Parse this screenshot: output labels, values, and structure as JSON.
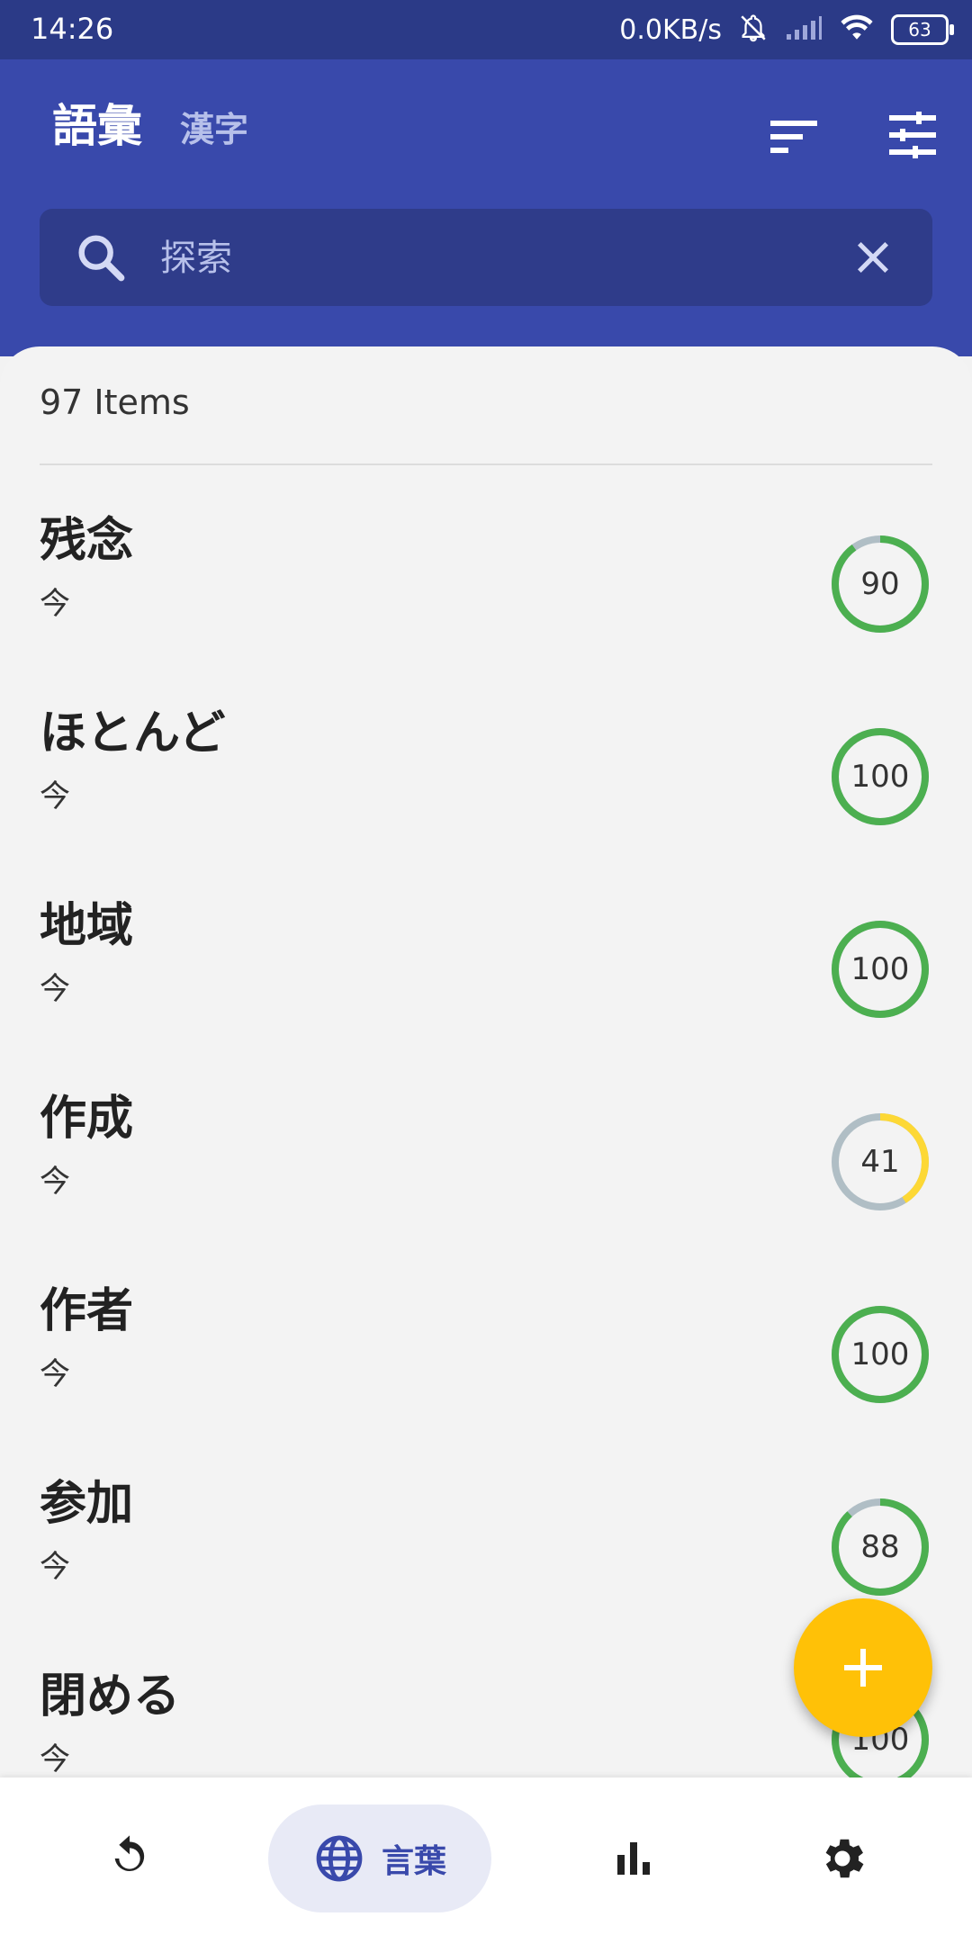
{
  "status_bar": {
    "time": "14:26",
    "net_speed": "0.0KB/s",
    "battery": "63"
  },
  "header": {
    "title": "語彙",
    "subtitle": "漢字"
  },
  "search": {
    "placeholder": "探索"
  },
  "list": {
    "count_label": "97 Items",
    "items": [
      {
        "word": "残念",
        "sub": "今",
        "score": "90",
        "progress": 0.9,
        "color": "#4caf50"
      },
      {
        "word": "ほとんど",
        "sub": "今",
        "score": "100",
        "progress": 1.0,
        "color": "#4caf50"
      },
      {
        "word": "地域",
        "sub": "今",
        "score": "100",
        "progress": 1.0,
        "color": "#4caf50"
      },
      {
        "word": "作成",
        "sub": "今",
        "score": "41",
        "progress": 0.41,
        "color": "#fdd835"
      },
      {
        "word": "作者",
        "sub": "今",
        "score": "100",
        "progress": 1.0,
        "color": "#4caf50"
      },
      {
        "word": "参加",
        "sub": "今",
        "score": "88",
        "progress": 0.88,
        "color": "#4caf50"
      },
      {
        "word": "閉める",
        "sub": "今",
        "score": "100",
        "progress": 1.0,
        "color": "#4caf50"
      }
    ]
  },
  "bottom_nav": {
    "active_label": "言葉"
  },
  "colors": {
    "primary": "#3949ab",
    "status_bar": "#2b3a87",
    "fab": "#ffc107",
    "ring_track": "#b0bec5"
  },
  "icons": {
    "sort": "sort-icon",
    "filter": "tune-icon",
    "search": "search-icon",
    "clear": "close-icon",
    "fab": "plus-icon",
    "nav_review": "replay-icon",
    "nav_words": "globe-icon",
    "nav_stats": "bar-chart-icon",
    "nav_settings": "gear-icon"
  }
}
